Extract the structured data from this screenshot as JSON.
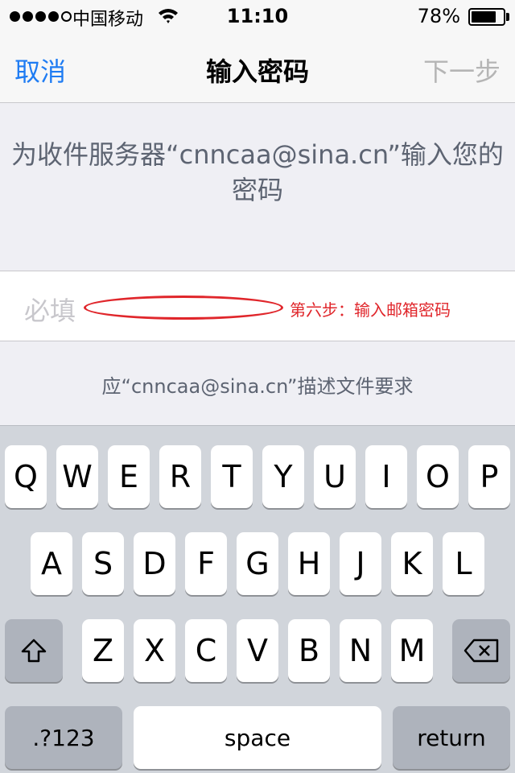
{
  "status_bar": {
    "carrier": "中国移动",
    "time": "11:10",
    "battery_percent": "78%",
    "battery_level": 0.78,
    "signal_bars": 4,
    "icons": [
      "signal-dots-icon",
      "wifi-icon",
      "battery-icon"
    ]
  },
  "nav": {
    "cancel_label": "取消",
    "title": "输入密码",
    "next_label": "下一步"
  },
  "prompt": {
    "text": "为收件服务器“cnncaa@sina.cn”输入您的密码"
  },
  "password_field": {
    "placeholder": "必填",
    "value": ""
  },
  "annotation": {
    "text": "第六步：输入邮箱密码",
    "color": "#e0262b"
  },
  "footer": {
    "text": "应“cnncaa@sina.cn”描述文件要求"
  },
  "keyboard": {
    "row1": [
      "Q",
      "W",
      "E",
      "R",
      "T",
      "Y",
      "U",
      "I",
      "O",
      "P"
    ],
    "row2": [
      "A",
      "S",
      "D",
      "F",
      "G",
      "H",
      "J",
      "K",
      "L"
    ],
    "row3": [
      "Z",
      "X",
      "C",
      "V",
      "B",
      "N",
      "M"
    ],
    "numbers_label": ".?123",
    "space_label": "space",
    "return_label": "return",
    "shift_icon": "shift-icon",
    "delete_icon": "delete-icon"
  },
  "colors": {
    "accent": "#1f7cf3",
    "disabled": "#b5b5b5",
    "background": "#efeff4",
    "keyboard_bg": "#d1d5db"
  }
}
